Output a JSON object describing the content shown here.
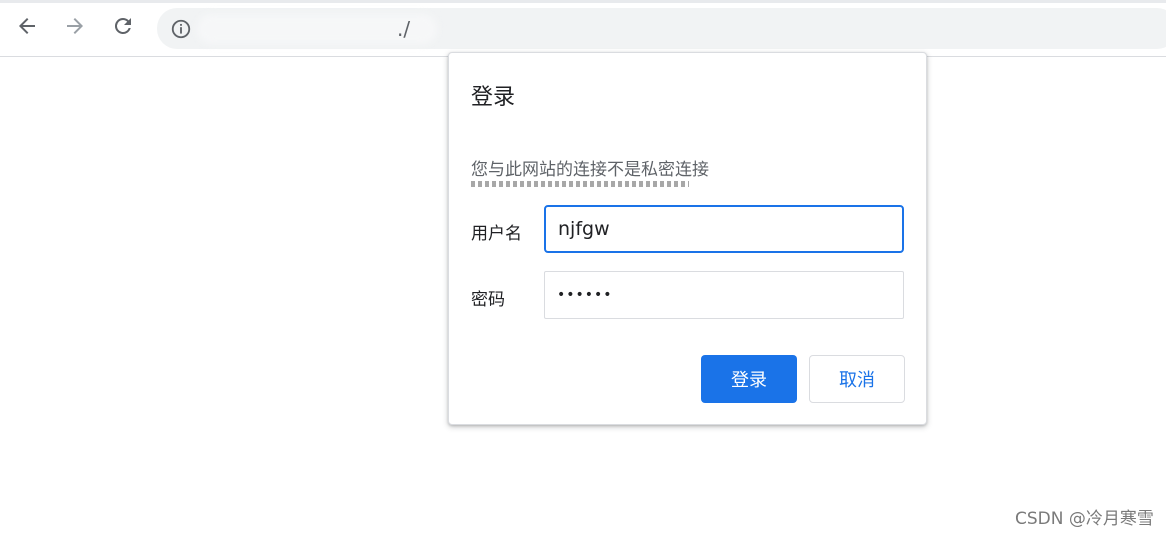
{
  "browser": {
    "url_visible_suffix": "./",
    "icons": {
      "back": "arrow-left-icon",
      "forward": "arrow-right-icon",
      "reload": "reload-icon",
      "site_info": "info-icon"
    }
  },
  "dialog": {
    "title": "登录",
    "warning": "您与此网站的连接不是私密连接",
    "username_label": "用户名",
    "username_value": "njfgw",
    "password_label": "密码",
    "password_value": "••••••",
    "login_button": "登录",
    "cancel_button": "取消"
  },
  "watermark": "CSDN @冷月寒雪",
  "colors": {
    "accent": "#1a73e8",
    "text_primary": "#202124",
    "text_secondary": "#5f6368"
  }
}
